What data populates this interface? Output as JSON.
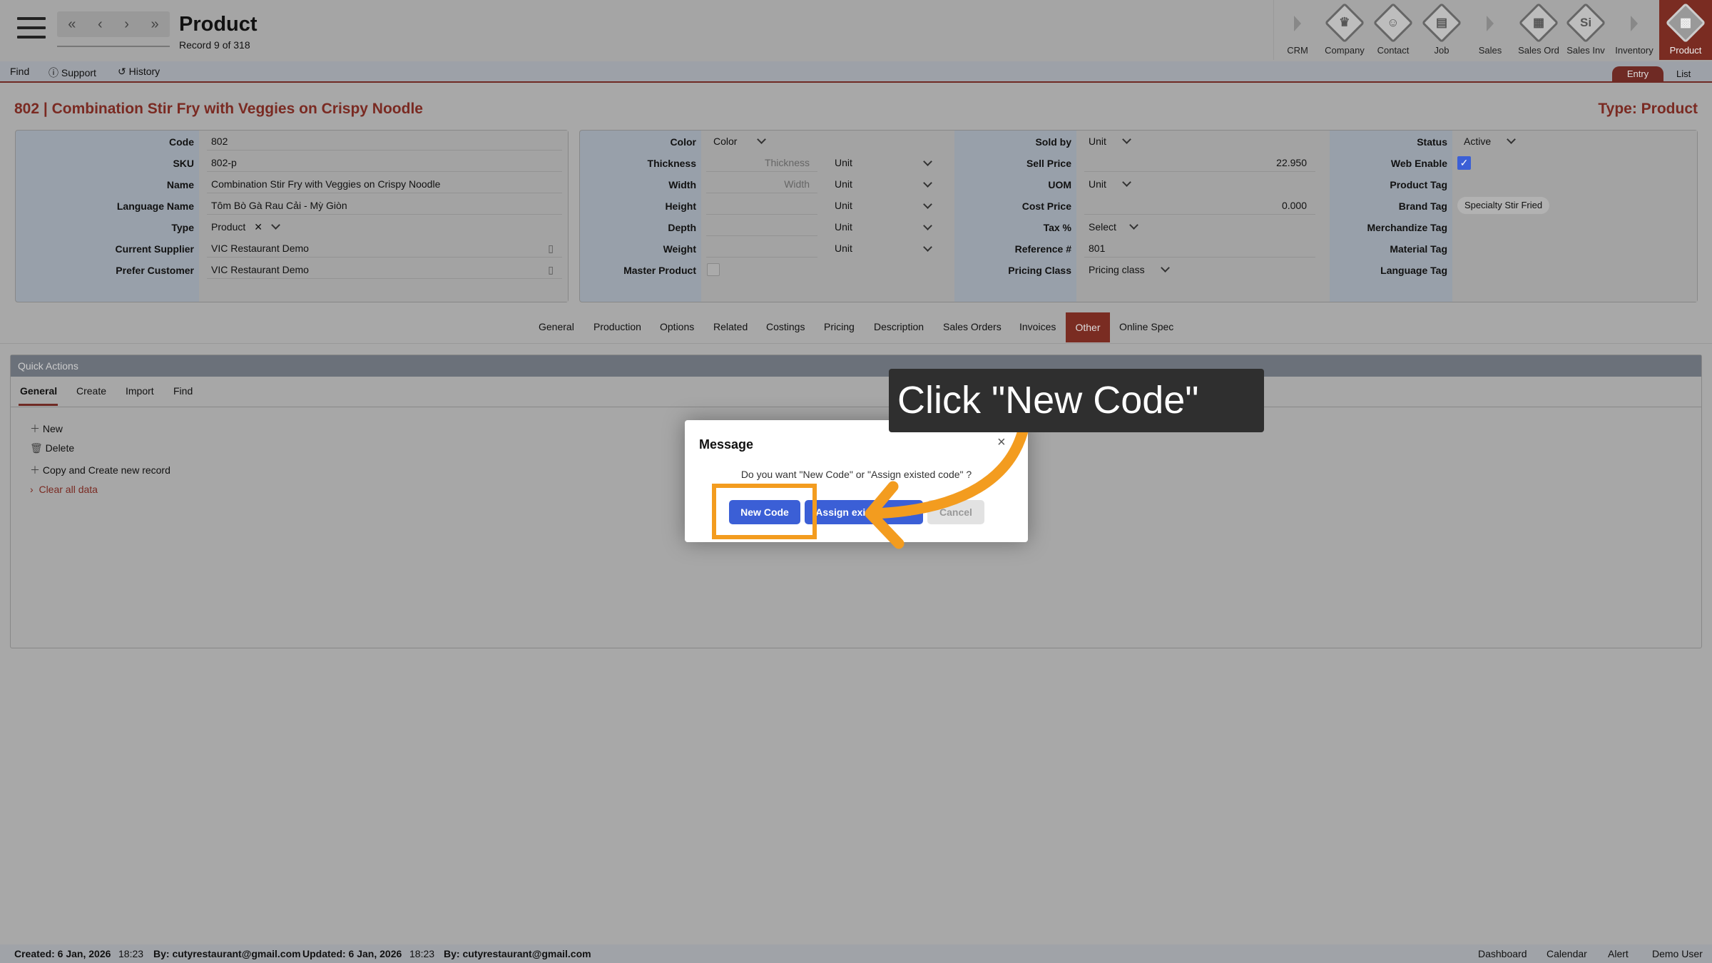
{
  "header": {
    "title": "Product",
    "record": "Record 9 of 318",
    "nav": [
      "«",
      "‹",
      "›",
      "»"
    ]
  },
  "modules": [
    {
      "label": "CRM",
      "kind": "arrow"
    },
    {
      "label": "Company",
      "kind": "icon",
      "glyph": "♛"
    },
    {
      "label": "Contact",
      "kind": "icon",
      "glyph": "☺"
    },
    {
      "label": "Job",
      "kind": "icon",
      "glyph": "▤"
    },
    {
      "label": "Sales",
      "kind": "arrow"
    },
    {
      "label": "Sales Ord",
      "kind": "icon",
      "glyph": "▦"
    },
    {
      "label": "Sales Inv",
      "kind": "icon",
      "glyph": "Si"
    },
    {
      "label": "Inventory",
      "kind": "arrow"
    },
    {
      "label": "Product",
      "kind": "icon",
      "glyph": "▩",
      "active": true
    }
  ],
  "toolbar": {
    "find": "Find",
    "support": "Support",
    "history": "History",
    "entry": "Entry",
    "list": "List"
  },
  "record": {
    "title": "802 | Combination Stir Fry with Veggies on Crispy Noodle",
    "type": "Type: Product"
  },
  "col1": {
    "labels": [
      "Code",
      "SKU",
      "Name",
      "Language Name",
      "Type",
      "Current Supplier",
      "Prefer Customer"
    ],
    "values": [
      "802",
      "802-p",
      "Combination Stir Fry with Veggies on Crispy Noodle",
      "Tôm Bò Gà Rau Cải - Mỳ Giòn",
      "Product",
      "VIC Restaurant Demo",
      "VIC Restaurant Demo"
    ]
  },
  "col2": {
    "labels": [
      "Color",
      "Thickness",
      "Width",
      "Height",
      "Depth",
      "Weight",
      "Master Product"
    ],
    "color_value": "Color",
    "thickness_ph": "Thickness",
    "width_ph": "Width",
    "unit": "Unit"
  },
  "col3": {
    "labels": [
      "Sold by",
      "Sell Price",
      "UOM",
      "Cost Price",
      "Tax %",
      "Reference #",
      "Pricing Class"
    ],
    "sold_by": "Unit",
    "sell_price": "22.950",
    "uom": "Unit",
    "cost_price": "0.000",
    "tax": "Select",
    "reference": "801",
    "pricing_class": "Pricing class"
  },
  "col4": {
    "labels": [
      "Status",
      "Web Enable",
      "Product Tag",
      "Brand Tag",
      "Merchandize Tag",
      "Material Tag",
      "Language Tag"
    ],
    "status": "Active",
    "brand_tag": "Specialty Stir Fried"
  },
  "tabs": [
    "General",
    "Production",
    "Options",
    "Related",
    "Costings",
    "Pricing",
    "Description",
    "Sales Orders",
    "Invoices",
    "Other",
    "Online Spec"
  ],
  "quick_actions": {
    "title": "Quick Actions",
    "tabs": [
      "General",
      "Create",
      "Import",
      "Find"
    ],
    "items": [
      "New",
      "Delete",
      "Copy and Create new record",
      "Clear all data"
    ]
  },
  "dialog": {
    "title": "Message",
    "message": "Do you want \"New Code\" or \"Assign existed code\" ?",
    "new_code": "New Code",
    "assign": "Assign existed code",
    "cancel": "Cancel"
  },
  "callout": "Click \"New Code\"",
  "footer": {
    "created": "Created: 6 Jan, 2026",
    "created_time": "18:23",
    "created_by": "By: cutyrestaurant@gmail.com",
    "updated": "Updated: 6 Jan, 2026",
    "updated_time": "18:23",
    "updated_by": "By: cutyrestaurant@gmail.com",
    "links": [
      "Dashboard",
      "Calendar",
      "Alert",
      "Demo User"
    ]
  },
  "colors": {
    "accent": "#7a2c22",
    "button_blue": "#3b5fd6",
    "highlight": "#f39c1f",
    "callout_bg": "#2f2f2f"
  }
}
